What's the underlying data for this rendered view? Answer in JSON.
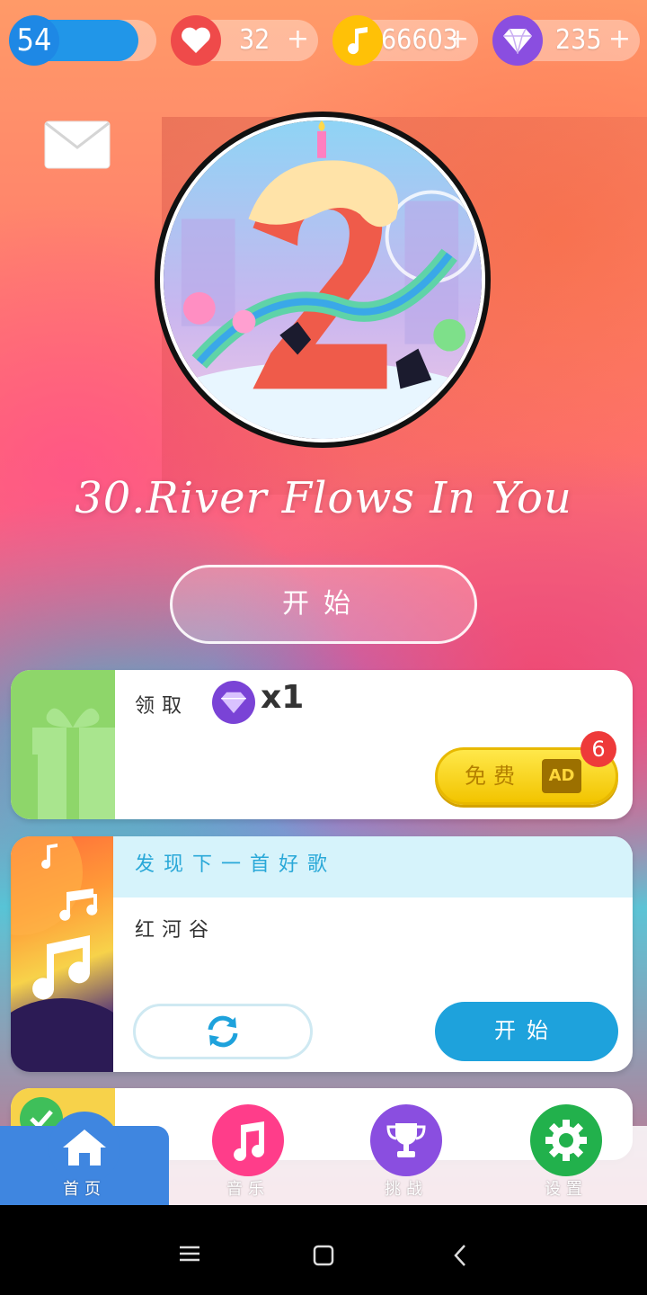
{
  "top_bar": {
    "level": "54",
    "lives": "32",
    "coins": "66603",
    "gems": "235",
    "plus_label": "+",
    "heart_color": "#ef4a4a",
    "coin_color": "#ffc107",
    "gem_color": "#8a4ee0",
    "level_color": "#1e88e5"
  },
  "mail": {
    "icon": "envelope-icon"
  },
  "song": {
    "title": "30.River Flows In You",
    "start_label": "开始"
  },
  "gift_card": {
    "label": "领取",
    "reward_qty": "x1",
    "free_label": "免费",
    "ad_label": "AD",
    "badge_count": "6"
  },
  "discover_card": {
    "header": "发现下一首好歌",
    "song_name": "红河谷",
    "start_label": "开始"
  },
  "nav": {
    "items": [
      {
        "label": "首页",
        "icon": "home-icon",
        "color": "#3f86e0"
      },
      {
        "label": "音乐",
        "icon": "music-icon",
        "color": "#ff3d8a"
      },
      {
        "label": "挑战",
        "icon": "trophy-icon",
        "color": "#8a4ee0"
      },
      {
        "label": "设置",
        "icon": "gear-icon",
        "color": "#22b14c"
      }
    ]
  }
}
